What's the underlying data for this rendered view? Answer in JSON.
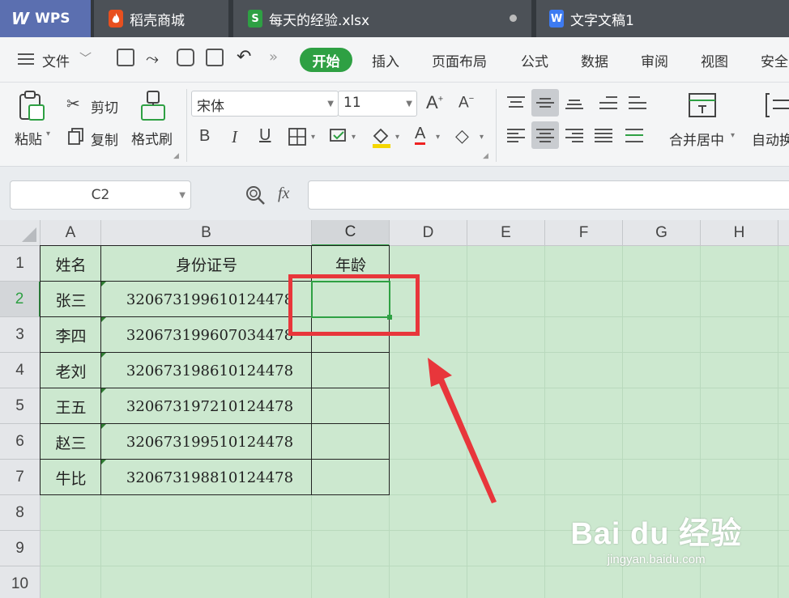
{
  "tabs": [
    {
      "label": "WPS",
      "logo": "W"
    },
    {
      "label": "稻壳商城",
      "icon": "flame-icon"
    },
    {
      "label": "每天的经验.xlsx",
      "icon": "spreadsheet-icon"
    },
    {
      "label": "文字文稿1",
      "icon": "writer-icon"
    }
  ],
  "menu": {
    "file": "文件",
    "start": "开始",
    "items": [
      "插入",
      "页面布局",
      "公式",
      "数据",
      "审阅",
      "视图",
      "安全"
    ]
  },
  "ribbon": {
    "paste": "粘贴",
    "cut": "剪切",
    "copy": "复制",
    "format_painter": "格式刷",
    "font_name": "宋体",
    "font_size": "11",
    "bold": "B",
    "italic": "I",
    "underline": "U",
    "font_color_letter": "A",
    "merge_center": "合并居中",
    "auto_wrap": "自动换",
    "increase_font": "A",
    "decrease_font": "A"
  },
  "formula_bar": {
    "name_box": "C2",
    "fx": "fx",
    "content": ""
  },
  "sheet": {
    "columns": [
      "A",
      "B",
      "C",
      "D",
      "E",
      "F",
      "G",
      "H"
    ],
    "rows": [
      "1",
      "2",
      "3",
      "4",
      "5",
      "6",
      "7",
      "8",
      "9",
      "10"
    ],
    "selected_cell": "C2",
    "header": [
      "姓名",
      "身份证号",
      "年龄"
    ],
    "data": [
      [
        "张三",
        "320673199610124478",
        ""
      ],
      [
        "李四",
        "320673199607034478",
        ""
      ],
      [
        "老刘",
        "320673198610124478",
        ""
      ],
      [
        "王五",
        "320673197210124478",
        ""
      ],
      [
        "赵三",
        "320673199510124478",
        ""
      ],
      [
        "牛比",
        "320673198810124478",
        ""
      ]
    ],
    "background": "#cce8cf"
  },
  "annotation": {
    "color": "#e8363b"
  },
  "watermark": {
    "brand": "Bai du 经验",
    "url": "jingyan.baidu.com"
  },
  "colors": {
    "accent": "#2ea043",
    "tabbar": "#33383d",
    "wps_tab": "#5b6fb0"
  }
}
